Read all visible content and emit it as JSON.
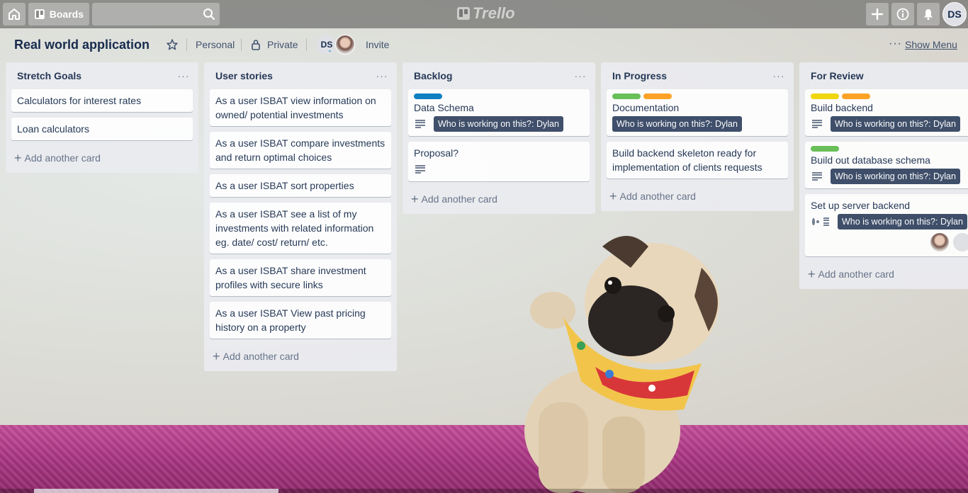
{
  "colors": {
    "label_blue": "#0079bf",
    "label_green": "#61bd4f",
    "label_orange": "#ff9f1a",
    "label_yellow": "#f2d600",
    "badge_bg": "#344563"
  },
  "topbar": {
    "boards_label": "Boards",
    "logo_text": "Trello",
    "avatar_initials": "DS"
  },
  "board": {
    "title": "Real world application",
    "team": "Personal",
    "visibility": "Private",
    "member_initials": "DS",
    "invite_label": "Invite",
    "show_menu_label": "Show Menu",
    "add_card_label": "Add another card"
  },
  "lists": [
    {
      "title": "Stretch Goals",
      "cards": [
        {
          "title": "Calculators for interest rates"
        },
        {
          "title": "Loan calculators"
        }
      ]
    },
    {
      "title": "User stories",
      "cards": [
        {
          "title": "As a user ISBAT view information on owned/ potential investments"
        },
        {
          "title": "As a user ISBAT compare investments and return optimal choices"
        },
        {
          "title": "As a user ISBAT sort properties"
        },
        {
          "title": "As a user ISBAT see a list of my investments with related information eg. date/ cost/ return/ etc."
        },
        {
          "title": "As a user ISBAT share investment profiles with secure links"
        },
        {
          "title": "As a user ISBAT View past pricing history on a property"
        }
      ]
    },
    {
      "title": "Backlog",
      "cards": [
        {
          "title": "Data Schema",
          "badge": "Who is working on this?: Dylan"
        },
        {
          "title": "Proposal?"
        }
      ]
    },
    {
      "title": "In Progress",
      "cards": [
        {
          "title": "Documentation",
          "badge": "Who is working on this?: Dylan"
        },
        {
          "title": "Build backend skeleton ready for implementation of clients requests"
        }
      ]
    },
    {
      "title": "For Review",
      "cards": [
        {
          "title": "Build backend",
          "badge": "Who is working on this?: Dylan"
        },
        {
          "title": "Build out database schema",
          "badge": "Who is working on this?: Dylan"
        },
        {
          "title": "Set up server backend",
          "badge": "Who is working on this?: Dylan"
        }
      ]
    }
  ]
}
